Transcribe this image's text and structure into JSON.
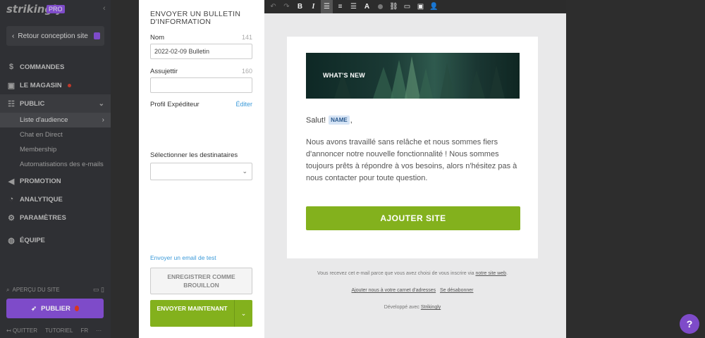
{
  "sidebar": {
    "logo": "strikingly",
    "badge": "PRO",
    "back_label": "Retour conception site",
    "nav": {
      "commandes": "COMMANDES",
      "magasin": "LE MAGASIN",
      "public": "PUBLIC",
      "sub_audience": "Liste d'audience",
      "sub_chat": "Chat en Direct",
      "sub_membership": "Membership",
      "sub_auto": "Automatisations des e-mails",
      "promotion": "PROMOTION",
      "analytique": "ANALYTIQUE",
      "parametres": "PARAMÈTRES",
      "equipe": "ÉQUIPE"
    },
    "preview_label": "APERÇU DU SITE",
    "publish_label": "PUBLIER",
    "bottom": {
      "quit": "QUITTER",
      "tutorial": "TUTORIEL",
      "lang": "FR",
      "more": "···"
    }
  },
  "form": {
    "title": "ENVOYER UN BULLETIN D'INFORMATION",
    "name_label": "Nom",
    "name_count": "141",
    "name_value": "2022-02-09 Bulletin",
    "subject_label": "Assujettir",
    "subject_count": "160",
    "subject_value": "",
    "sender_label": "Profil Expéditeur",
    "edit_label": "Éditer",
    "recipients_label": "Sélectionner les destinataires",
    "test_link": "Envoyer un email de test",
    "draft_button": "ENREGISTRER COMME BROUILLON",
    "send_button": "ENVOYER MAINTENANT"
  },
  "email": {
    "banner_text": "WHAT'S NEW",
    "greeting": "Salut!",
    "name_tag": "NAME",
    "greeting_suffix": ",",
    "body": "Nous avons travaillé sans relâche et nous sommes fiers d'annoncer notre nouvelle fonctionnalité ! Nous sommes toujours prêts à répondre à vos besoins, alors n'hésitez pas à nous contacter pour toute question.",
    "cta": "AJOUTER SITE",
    "footer_notice": "Vous recevez cet e-mail parce que vous avez choisi de vous inscrire via",
    "footer_notice_link": "notre site web",
    "footer_notice_end": ".",
    "footer_add": "Ajouter nous à votre carnet d'adresses",
    "footer_unsub": "Se désabonner",
    "footer_powered": "Développé avec",
    "footer_powered_link": "Strikingly"
  },
  "help_label": "?"
}
